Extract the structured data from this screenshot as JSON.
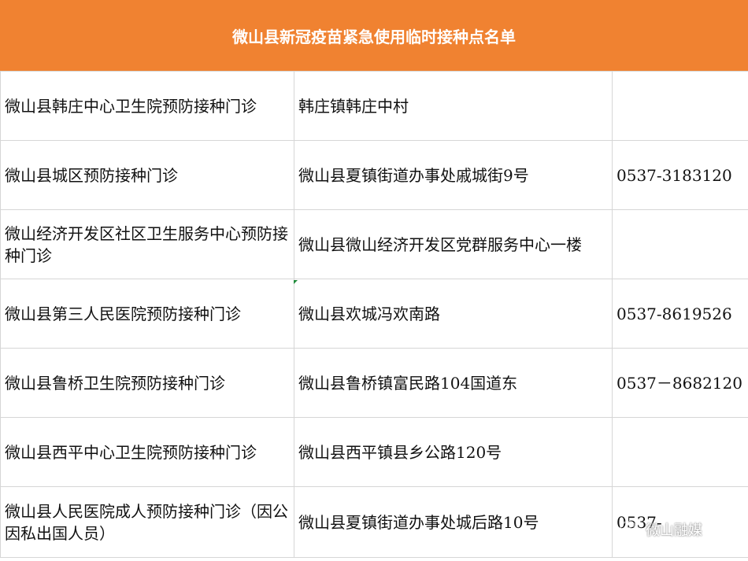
{
  "title": "微山县新冠疫苗紧急使用临时接种点名单",
  "rows": [
    {
      "name": "微山县韩庄中心卫生院预防接种门诊",
      "address": "韩庄镇韩庄中村",
      "phone": ""
    },
    {
      "name": "微山县城区预防接种门诊",
      "address": "微山县夏镇街道办事处戚城街9号",
      "phone": "0537-3183120"
    },
    {
      "name": "微山经济开发区社区卫生服务中心预防接种门诊",
      "address": "微山县微山经济开发区党群服务中心一楼",
      "phone": ""
    },
    {
      "name": "微山县第三人民医院预防接种门诊",
      "address": "微山县欢城冯欢南路",
      "phone": "0537-8619526"
    },
    {
      "name": "微山县鲁桥卫生院预防接种门诊",
      "address": "微山县鲁桥镇富民路104国道东",
      "phone": "0537－8682120"
    },
    {
      "name": "微山县西平中心卫生院预防接种门诊",
      "address": "微山县西平镇县乡公路120号",
      "phone": ""
    },
    {
      "name": "微山县人民医院成人预防接种门诊（因公因私出国人员）",
      "address": "微山县夏镇街道办事处城后路10号",
      "phone": "0537-"
    }
  ],
  "watermark": {
    "icon": "wechat-icon",
    "text": "微山融媒"
  }
}
